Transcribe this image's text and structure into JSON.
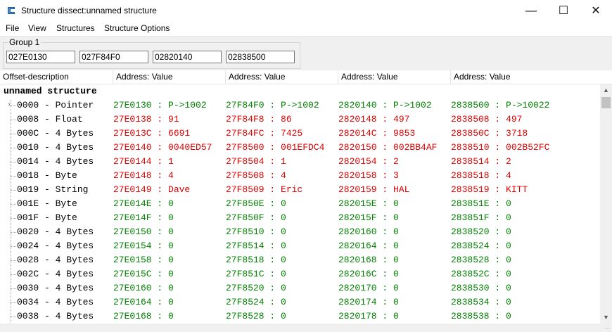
{
  "window": {
    "title": "Structure dissect:unnamed structure",
    "app_icon": "cheat-engine-icon",
    "minimize": "—",
    "maximize": "☐",
    "close": "✕"
  },
  "menu": [
    "File",
    "View",
    "Structures",
    "Structure Options"
  ],
  "group": {
    "label": "Group 1",
    "addresses": [
      "027E0130",
      "027F84F0",
      "02820140",
      "02838500"
    ]
  },
  "columns": [
    "Offset-description",
    "Address: Value",
    "Address: Value",
    "Address: Value",
    "Address: Value"
  ],
  "root_label": "unnamed structure",
  "rows": [
    {
      "desc": "0000 - Pointer",
      "expandable": true,
      "color": "green",
      "values": [
        "27E0130 : P->1002",
        "27F84F0 : P->1002",
        "2820140 : P->1002",
        "2838500 : P->10022"
      ]
    },
    {
      "desc": "0008 - Float",
      "color": "red",
      "values": [
        "27E0138 : 91",
        "27F84F8 : 86",
        "2820148 : 497",
        "2838508 : 497"
      ]
    },
    {
      "desc": "000C - 4 Bytes",
      "color": "red",
      "values": [
        "27E013C : 6691",
        "27F84FC : 7425",
        "282014C : 9853",
        "283850C : 3718"
      ]
    },
    {
      "desc": "0010 - 4 Bytes",
      "color": "red",
      "values": [
        "27E0140 : 0040ED57",
        "27F8500 : 001EFDC4",
        "2820150 : 002BB4AF",
        "2838510 : 002B52FC"
      ]
    },
    {
      "desc": "0014 - 4 Bytes",
      "color": "red",
      "values": [
        "27E0144 : 1",
        "27F8504 : 1",
        "2820154 : 2",
        "2838514 : 2"
      ]
    },
    {
      "desc": "0018 - Byte",
      "color": "red",
      "values": [
        "27E0148 : 4",
        "27F8508 : 4",
        "2820158 : 3",
        "2838518 : 4"
      ]
    },
    {
      "desc": "0019 - String",
      "color": "red",
      "values": [
        "27E0149 : Dave",
        "27F8509 : Eric",
        "2820159 : HAL",
        "2838519 : KITT"
      ]
    },
    {
      "desc": "001E - Byte",
      "color": "green",
      "values": [
        "27E014E : 0",
        "27F850E : 0",
        "282015E : 0",
        "283851E : 0"
      ]
    },
    {
      "desc": "001F - Byte",
      "color": "green",
      "values": [
        "27E014F : 0",
        "27F850F : 0",
        "282015F : 0",
        "283851F : 0"
      ]
    },
    {
      "desc": "0020 - 4 Bytes",
      "color": "green",
      "values": [
        "27E0150 : 0",
        "27F8510 : 0",
        "2820160 : 0",
        "2838520 : 0"
      ]
    },
    {
      "desc": "0024 - 4 Bytes",
      "color": "green",
      "values": [
        "27E0154 : 0",
        "27F8514 : 0",
        "2820164 : 0",
        "2838524 : 0"
      ]
    },
    {
      "desc": "0028 - 4 Bytes",
      "color": "green",
      "values": [
        "27E0158 : 0",
        "27F8518 : 0",
        "2820168 : 0",
        "2838528 : 0"
      ]
    },
    {
      "desc": "002C - 4 Bytes",
      "color": "green",
      "values": [
        "27E015C : 0",
        "27F851C : 0",
        "282016C : 0",
        "283852C : 0"
      ]
    },
    {
      "desc": "0030 - 4 Bytes",
      "color": "green",
      "values": [
        "27E0160 : 0",
        "27F8520 : 0",
        "2820170 : 0",
        "2838530 : 0"
      ]
    },
    {
      "desc": "0034 - 4 Bytes",
      "color": "green",
      "values": [
        "27E0164 : 0",
        "27F8524 : 0",
        "2820174 : 0",
        "2838534 : 0"
      ]
    },
    {
      "desc": "0038 - 4 Bytes",
      "color": "green",
      "values": [
        "27E0168 : 0",
        "27F8528 : 0",
        "2820178 : 0",
        "2838538 : 0"
      ]
    }
  ],
  "colors": {
    "green": "#008000",
    "red": "#e00000"
  }
}
